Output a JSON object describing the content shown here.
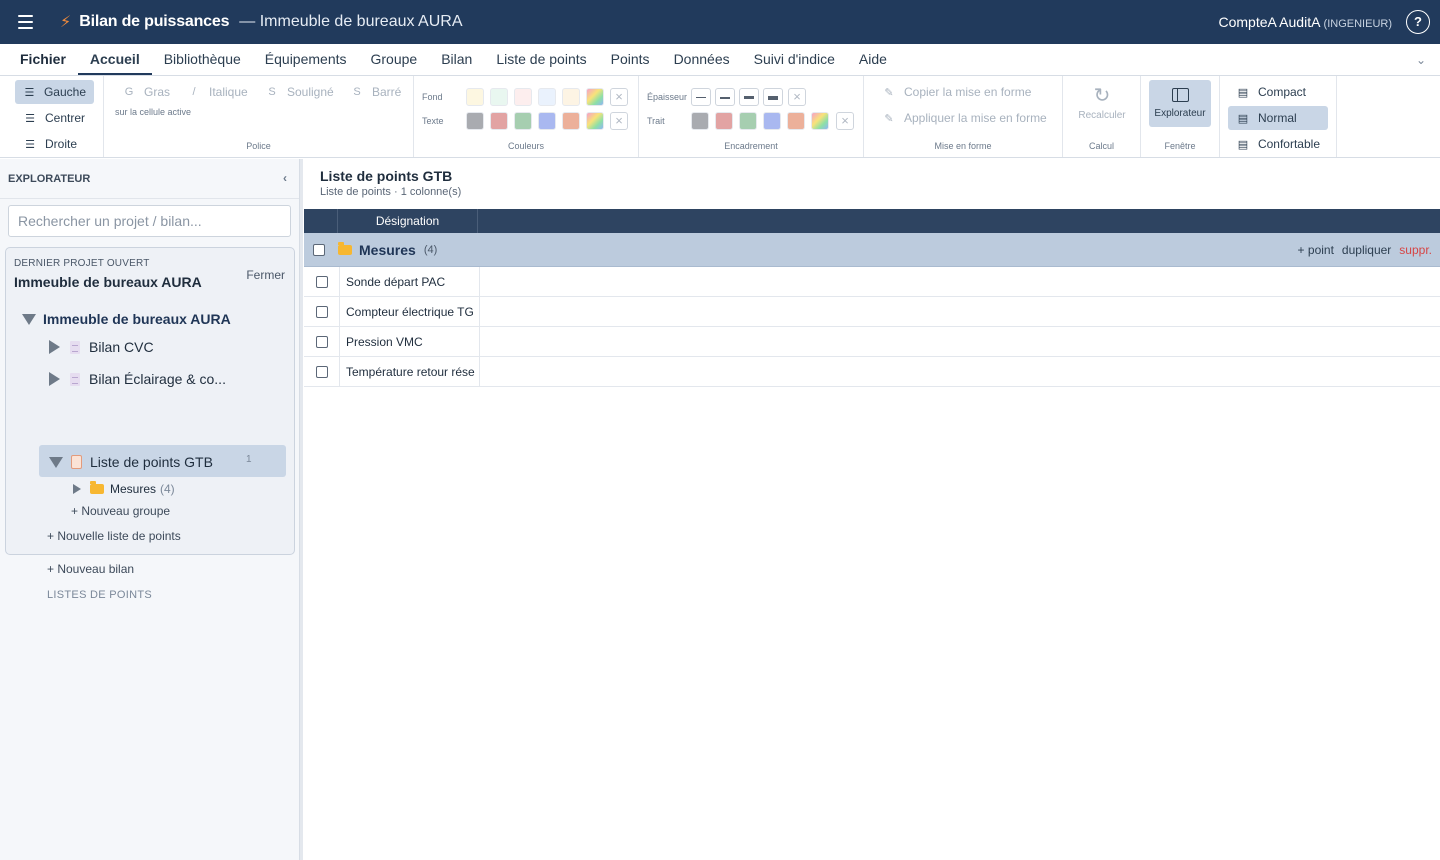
{
  "header": {
    "app_title": "Bilan de puissances",
    "document_title": "— Immeuble de bureaux AURA",
    "user_name": "CompteA AuditA",
    "user_role": "(INGENIEUR)",
    "help_label": "?"
  },
  "menu": {
    "items": [
      "Fichier",
      "Accueil",
      "Bibliothèque",
      "Équipements",
      "Groupe",
      "Bilan",
      "Liste de points",
      "Points",
      "Données",
      "Suivi d'indice",
      "Aide"
    ],
    "active": "Accueil"
  },
  "ribbon": {
    "align": {
      "left": "Gauche",
      "center": "Centrer",
      "right": "Droite"
    },
    "police": {
      "bold": "Gras",
      "italic": "Italique",
      "underline": "Souligné",
      "strike": "Barré",
      "hint": "sur la cellule active",
      "label": "Police"
    },
    "couleurs": {
      "fond_label": "Fond",
      "texte_label": "Texte",
      "label": "Couleurs",
      "fond_swatches": [
        "#fdf7e1",
        "#e9f7f0",
        "#fdeeee",
        "#eaf2fd",
        "#fdf4e4"
      ],
      "texte_swatches": [
        "#a9abb0",
        "#e2a3a3",
        "#a6ceb0",
        "#a9b8f0",
        "#ecb09a"
      ]
    },
    "encadrement": {
      "epaisseur_label": "Épaisseur",
      "trait_label": "Trait",
      "label": "Encadrement",
      "trait_swatches": [
        "#a9abb0",
        "#e2a3a3",
        "#a6ceb0",
        "#a9b8f0",
        "#ecb09a"
      ]
    },
    "format": {
      "copy": "Copier la mise en forme",
      "apply": "Appliquer la mise en forme",
      "label": "Mise en forme"
    },
    "calcul": {
      "recalc": "Recalculer",
      "label": "Calcul"
    },
    "fenetre": {
      "explorer": "Explorateur",
      "label": "Fenêtre"
    },
    "density": {
      "compact": "Compact",
      "normal": "Normal",
      "comfortable": "Confortable",
      "selected": "Normal"
    }
  },
  "sidebar": {
    "title": "EXPLORATEUR",
    "search_placeholder": "Rechercher un projet / bilan...",
    "last_project_kicker": "DERNIER PROJET OUVERT",
    "last_project_name": "Immeuble de bureaux AURA",
    "close_label": "Fermer",
    "tree": {
      "root": "Immeuble de bureaux AURA",
      "bilans": [
        "Bilan CVC",
        "Bilan Éclairage & co..."
      ],
      "new_bilan": "+ Nouveau bilan",
      "lists_section": "LISTES DE POINTS",
      "active_list": "Liste de points GTB",
      "active_list_count": "1",
      "group_name": "Mesures",
      "group_count": "(4)",
      "new_group": "+ Nouveau groupe",
      "new_list": "+ Nouvelle liste de points"
    }
  },
  "main": {
    "title": "Liste de points GTB",
    "subtitle": "Liste de points · 1 colonne(s)",
    "column": "Désignation",
    "group": {
      "name": "Mesures",
      "count": "(4)",
      "add": "+ point",
      "duplicate": "dupliquer",
      "delete": "suppr."
    },
    "rows": [
      "Sonde départ PAC",
      "Compteur électrique TG",
      "Pression VMC",
      "Température retour rése"
    ]
  }
}
